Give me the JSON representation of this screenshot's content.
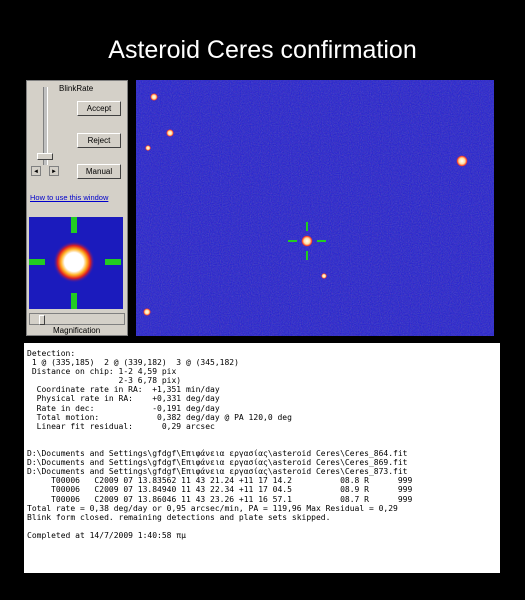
{
  "title": "Asteroid Ceres confirmation",
  "panel": {
    "blink_rate_label": "BlinkRate",
    "accept_label": "Accept",
    "reject_label": "Reject",
    "manual_label": "Manual",
    "prev_label": "◄",
    "next_label": "►",
    "howto_link": "How to use this window",
    "magnification_label": "Magnification"
  },
  "log": {
    "detection_header": "Detection:",
    "detection_points": " 1 @ (335,185)  2 @ (339,182)  3 @ (345,182)",
    "distance_line1": " Distance on chip: 1-2 4,59 pix",
    "distance_line2": "                   2-3 6,78 pix)",
    "metrics": [
      {
        "label": "  Coordinate rate in RA:",
        "value": "  +1,351",
        "unit": " min/day"
      },
      {
        "label": "  Physical rate in RA:  ",
        "value": "  +0,331",
        "unit": " deg/day"
      },
      {
        "label": "  Rate in dec:          ",
        "value": "  -0,191",
        "unit": " deg/day"
      },
      {
        "label": "  Total motion:         ",
        "value": "   0,382",
        "unit": " deg/day @ PA 120,0 deg"
      },
      {
        "label": "  Linear fit residual:  ",
        "value": "    0,29",
        "unit": " arcsec"
      }
    ],
    "files": [
      "D:\\Documents and Settings\\gfdgf\\Επιφάνεια εργασίας\\asteroid Ceres\\Ceres_864.fit",
      "D:\\Documents and Settings\\gfdgf\\Επιφάνεια εργασίας\\asteroid Ceres\\Ceres_869.fit",
      "D:\\Documents and Settings\\gfdgf\\Επιφάνεια εργασίας\\asteroid Ceres\\Ceres_873.fit"
    ],
    "observations": [
      "     T00006   C2009 07 13.83562 11 43 21.24 +11 17 14.2          08.8 R      999",
      "     T00006   C2009 07 13.84940 11 43 22.34 +11 17 04.5          08.9 R      999",
      "     T00006   C2009 07 13.86046 11 43 23.26 +11 16 57.1          08.7 R      999"
    ],
    "total_rate": "Total rate = 0,38 deg/day or 0,95 arcsec/min, PA = 119,96 Max Residual = 0,29",
    "blink_closed": "Blink form closed. remaining detections and plate sets skipped.",
    "completed": "Completed at 14/7/2009 1:40:58 πμ"
  }
}
